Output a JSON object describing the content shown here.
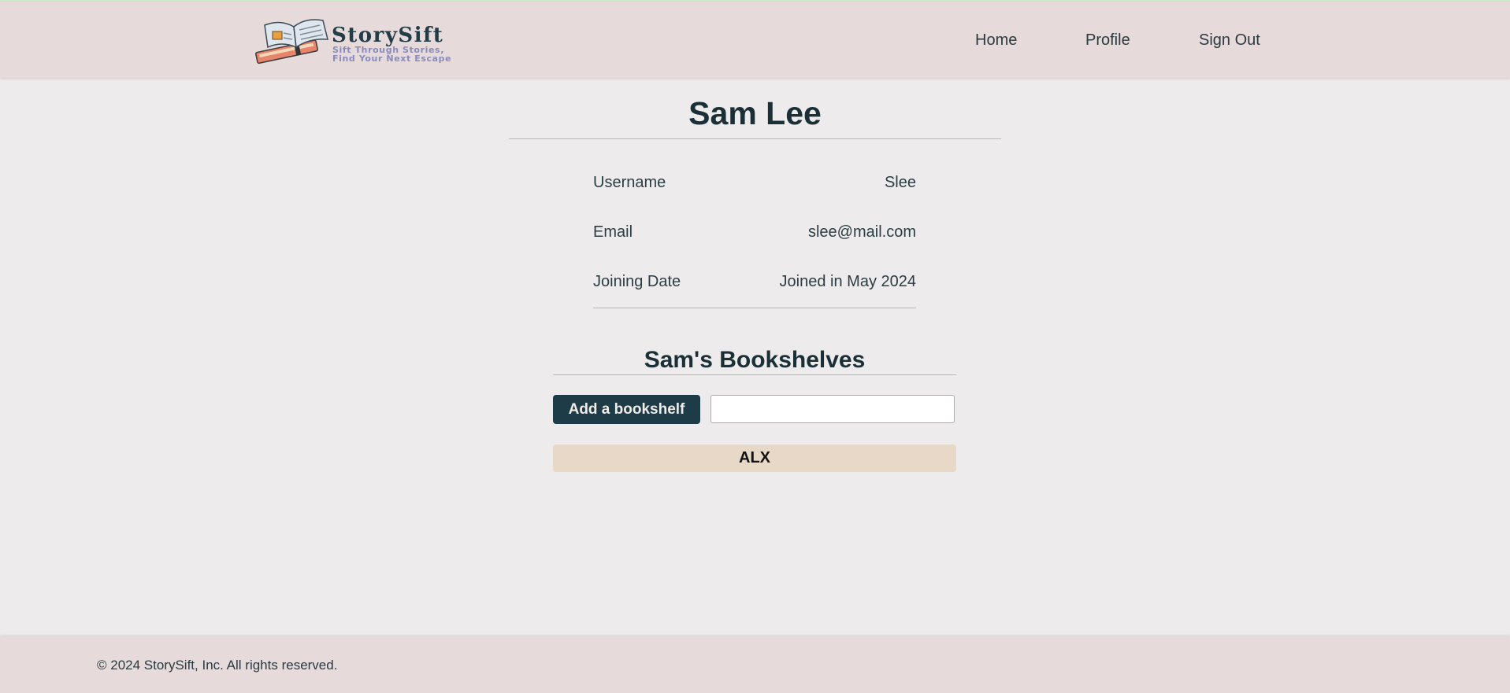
{
  "brand": {
    "name": "StorySift",
    "tagline_line1": "Sift Through Stories,",
    "tagline_line2": "Find Your Next Escape",
    "logo_icon": "open-book-icon"
  },
  "nav": {
    "home": "Home",
    "profile": "Profile",
    "sign_out": "Sign Out"
  },
  "profile": {
    "full_name": "Sam Lee",
    "fields": [
      {
        "label": "Username",
        "value": "Slee"
      },
      {
        "label": "Email",
        "value": "slee@mail.com"
      },
      {
        "label": "Joining Date",
        "value": "Joined in May 2024"
      }
    ]
  },
  "bookshelves": {
    "title": "Sam's Bookshelves",
    "add_button": "Add a bookshelf",
    "input_value": "",
    "items": [
      {
        "name": "ALX"
      }
    ]
  },
  "footer": {
    "copyright": "© 2024 StorySift, Inc. All rights reserved."
  },
  "colors": {
    "header_bg": "#e6dbda",
    "page_bg": "#eeebec",
    "button_bg": "#1e3c47",
    "shelf_item_bg": "#e8d8c8",
    "text_dark": "#1b2f37"
  }
}
